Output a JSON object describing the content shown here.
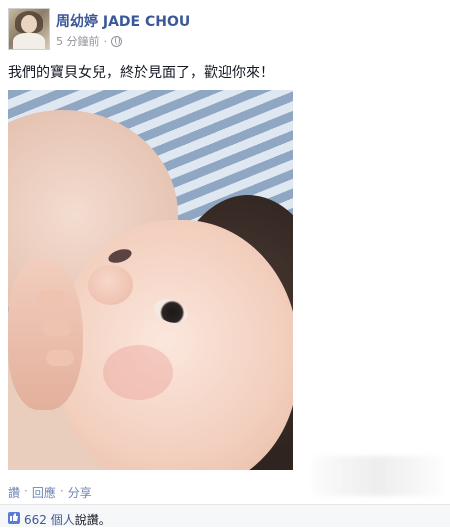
{
  "post": {
    "author": "周幼婷 JADE CHOU",
    "timestamp": "5 分鐘前",
    "separator": "·",
    "text": "我們的寶貝女兒，終於見面了，歡迎你來！"
  },
  "actions": {
    "like": "讚",
    "comment": "回應",
    "share": "分享",
    "dot": "·"
  },
  "likes": {
    "count_text": "662 個人",
    "suffix": "說讚。",
    "icon_char": "👍"
  },
  "icons": {
    "audience": "globe-icon",
    "like": "thumbs-up-icon"
  },
  "colors": {
    "link_blue": "#3b5998",
    "meta_gray": "#90949c"
  }
}
